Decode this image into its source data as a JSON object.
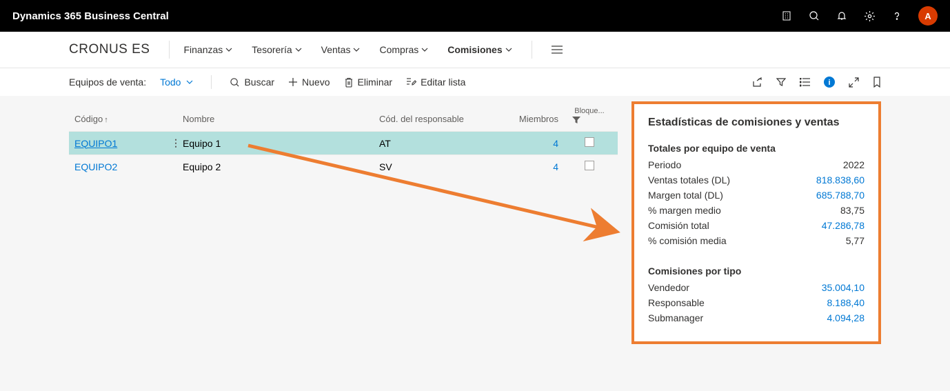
{
  "header": {
    "app_title": "Dynamics 365 Business Central",
    "avatar_initial": "A"
  },
  "nav": {
    "company": "CRONUS ES",
    "items": [
      {
        "label": "Finanzas",
        "active": false
      },
      {
        "label": "Tesorería",
        "active": false
      },
      {
        "label": "Ventas",
        "active": false
      },
      {
        "label": "Compras",
        "active": false
      },
      {
        "label": "Comisiones",
        "active": true
      }
    ]
  },
  "toolbar": {
    "page_label": "Equipos de venta:",
    "filter_label": "Todo",
    "actions": {
      "search": "Buscar",
      "new": "Nuevo",
      "delete": "Eliminar",
      "edit_list": "Editar lista"
    }
  },
  "table": {
    "headers": {
      "codigo": "Código",
      "nombre": "Nombre",
      "responsable": "Cód. del responsable",
      "miembros": "Miembros",
      "bloque": "Bloque..."
    },
    "rows": [
      {
        "codigo": "EQUIPO1",
        "nombre": "Equipo 1",
        "responsable": "AT",
        "miembros": "4",
        "selected": true
      },
      {
        "codigo": "EQUIPO2",
        "nombre": "Equipo 2",
        "responsable": "SV",
        "miembros": "4",
        "selected": false
      }
    ]
  },
  "stats": {
    "title": "Estadísticas de comisiones y ventas",
    "section1_title": "Totales por equipo de venta",
    "section1": [
      {
        "label": "Periodo",
        "value": "2022",
        "link": false
      },
      {
        "label": "Ventas totales (DL)",
        "value": "818.838,60",
        "link": true
      },
      {
        "label": "Margen total (DL)",
        "value": "685.788,70",
        "link": true
      },
      {
        "label": "% margen medio",
        "value": "83,75",
        "link": false
      },
      {
        "label": "Comisión total",
        "value": "47.286,78",
        "link": true
      },
      {
        "label": "% comisión media",
        "value": "5,77",
        "link": false
      }
    ],
    "section2_title": "Comisiones por tipo",
    "section2": [
      {
        "label": "Vendedor",
        "value": "35.004,10",
        "link": true
      },
      {
        "label": "Responsable",
        "value": "8.188,40",
        "link": true
      },
      {
        "label": "Submanager",
        "value": "4.094,28",
        "link": true
      }
    ]
  }
}
